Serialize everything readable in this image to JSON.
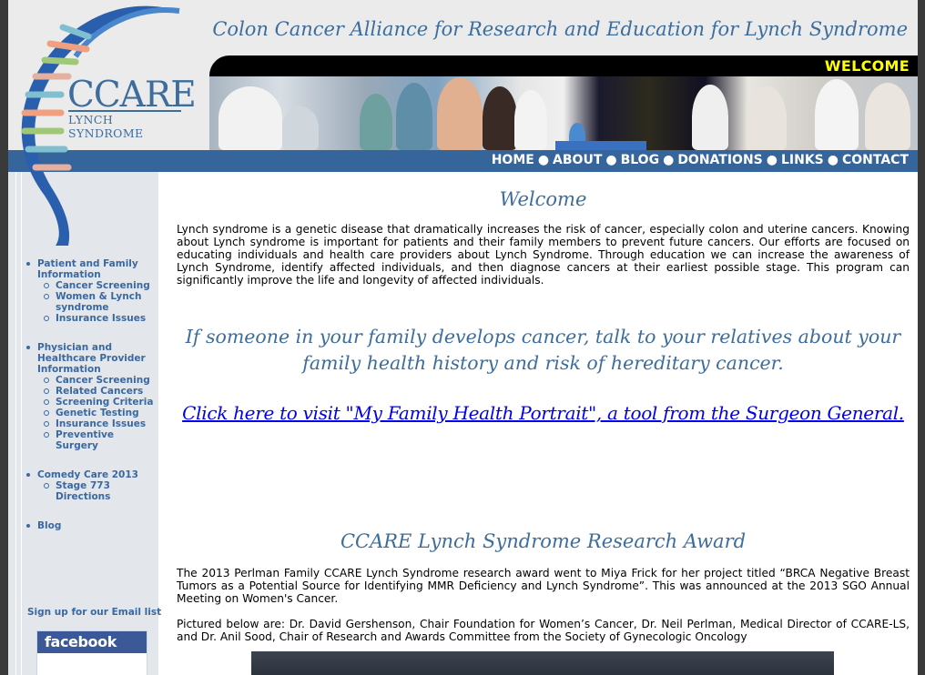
{
  "header": {
    "tagline": "Colon Cancer Alliance for Research and Education for Lynch Syndrome",
    "welcome": "WELCOME"
  },
  "logo": {
    "title": "CCARE",
    "subtitle": "LYNCH SYNDROME",
    "dna_colors": [
      "#2a5fae",
      "#f0a080",
      "#7fbfd0",
      "#a0c878",
      "#e6b0a0"
    ]
  },
  "nav": {
    "items": [
      "HOME",
      "ABOUT",
      "BLOG",
      "DONATIONS",
      "LINKS",
      "CONTACT"
    ],
    "separator": "●"
  },
  "sidebar": {
    "patient": {
      "label": "Patient and Family Information",
      "items": [
        "Cancer Screening",
        "Women & Lynch syndrome",
        "Insurance Issues"
      ]
    },
    "physician": {
      "label": "Physician and Healthcare Provider Information",
      "items": [
        "Cancer Screening",
        "Related Cancers",
        "Screening Criteria",
        "Genetic Testing",
        "Insurance Issues",
        "Preventive Surgery"
      ]
    },
    "comedy": {
      "label": "Comedy Care 2013",
      "items": [
        "Stage 773 Directions"
      ]
    },
    "blog": {
      "label": "Blog"
    },
    "signup": "Sign up for our Email list",
    "facebook": "facebook"
  },
  "main": {
    "welcome_heading": "Welcome",
    "intro": "Lynch syndrome is a genetic disease that dramatically increases the risk of cancer, especially colon and uterine cancers. Knowing about Lynch syndrome is important for patients and their family members to prevent future cancers. Our efforts are focused on educating individuals and health care providers about Lynch Syndrome. Through education we can increase the awareness of Lynch Syndrome, identify affected individuals, and then diagnose cancers at their earliest possible stage. This program can significantly improve the life and longevity of affected individuals.",
    "quote": "If someone in your family develops cancer, talk to your relatives about your family health history and risk of hereditary cancer.",
    "portrait_link": "Click here to visit \"My Family Health Portrait\", a tool from the Surgeon General.",
    "award_heading": "CCARE Lynch Syndrome Research Award",
    "award_text": "The 2013 Perlman Family CCARE Lynch Syndrome research award went to Miya Frick for her project titled “BRCA Negative Breast Tumors as a Potential Source for Identifying MMR Deficiency and Lynch Syndrome”. This was announced at the 2013 SGO Annual Meeting on Women's Cancer.",
    "pictured_text": "Pictured below are: Dr. David Gershenson, Chair Foundation for Women’s Cancer, Dr. Neil Perlman, Medical Director of CCARE-LS, and Dr. Anil Sood, Chair of Research and Awards Committee from the Society of Gynecologic Oncology"
  }
}
